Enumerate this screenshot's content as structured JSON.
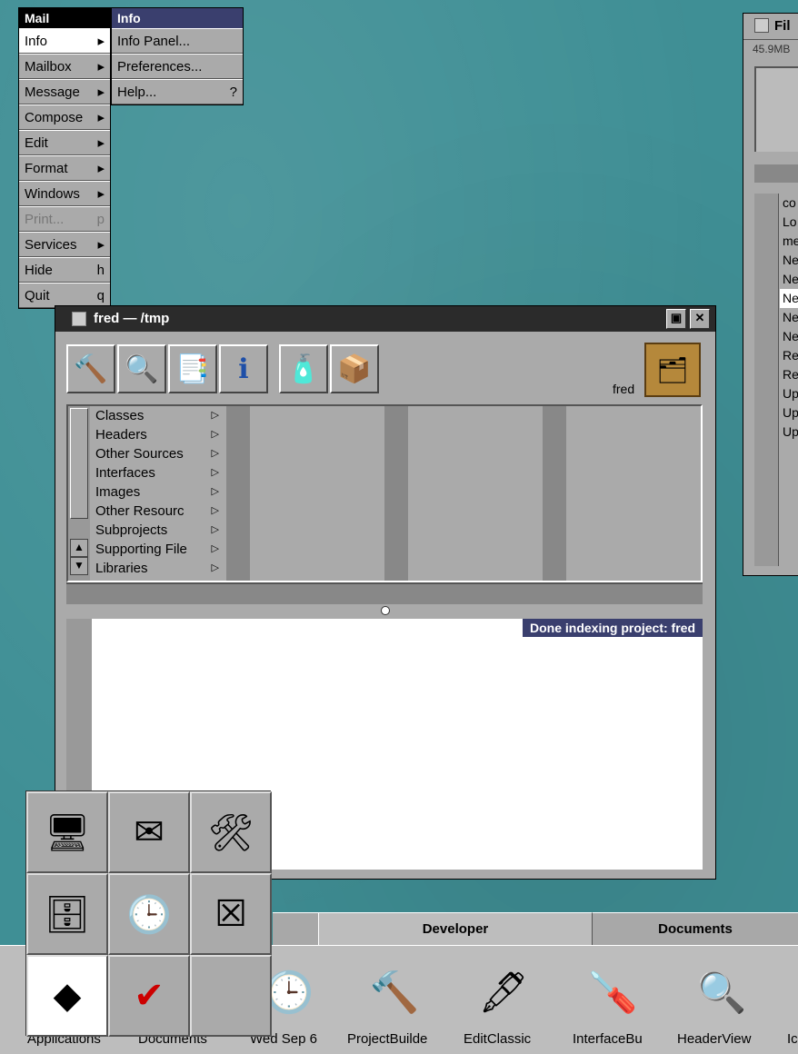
{
  "menu_main": {
    "title": "Mail",
    "items": [
      {
        "label": "Info",
        "key": "▸"
      },
      {
        "label": "Mailbox",
        "key": "▸"
      },
      {
        "label": "Message",
        "key": "▸"
      },
      {
        "label": "Compose",
        "key": "▸"
      },
      {
        "label": "Edit",
        "key": "▸"
      },
      {
        "label": "Format",
        "key": "▸"
      },
      {
        "label": "Windows",
        "key": "▸"
      },
      {
        "label": "Print...",
        "key": "p"
      },
      {
        "label": "Services",
        "key": "▸"
      },
      {
        "label": "Hide",
        "key": "h"
      },
      {
        "label": "Quit",
        "key": "q"
      }
    ]
  },
  "menu_info": {
    "title": "Info",
    "items": [
      {
        "label": "Info Panel...",
        "key": ""
      },
      {
        "label": "Preferences...",
        "key": ""
      },
      {
        "label": "Help...",
        "key": "?"
      }
    ]
  },
  "project_window": {
    "title": "fred — /tmp",
    "project_name": "fred",
    "browser_items": [
      "Classes",
      "Headers",
      "Other Sources",
      "Interfaces",
      "Images",
      "Other Resourc",
      "Subprojects",
      "Supporting File",
      "Libraries"
    ],
    "status": "Done indexing project: fred"
  },
  "file_window": {
    "title": "Fil",
    "size": "45.9MB",
    "rows": [
      "co",
      "Lo",
      "me",
      "Ne",
      "Ne",
      "Ne",
      "Ne",
      "Ne",
      "Re",
      "Re",
      "Up",
      "Up",
      "Up"
    ]
  },
  "shelf": {
    "tabs": [
      "Developer",
      "Documents"
    ],
    "icons": [
      {
        "label": "Applications",
        "icon": "applications-folder-icon"
      },
      {
        "label": "Documents",
        "icon": "documents-folder-icon"
      },
      {
        "label": "Wed Sep 6",
        "icon": "clock-icon"
      },
      {
        "label": "ProjectBuilde",
        "icon": "hammer-icon"
      },
      {
        "label": "EditClassic",
        "icon": "edit-pen-icon"
      },
      {
        "label": "InterfaceBu",
        "icon": "screwdriver-icon"
      },
      {
        "label": "HeaderView",
        "icon": "magnifier-icon"
      },
      {
        "label": "Ic",
        "icon": "app-icon"
      }
    ]
  },
  "dock": {
    "cells": [
      "terminal-icon",
      "mail-icon",
      "project-builder-icon",
      "file-viewer-icon",
      "clock-icon",
      "preferences-icon",
      "next-logo-icon",
      "check-icon",
      "empty"
    ]
  },
  "colors": {
    "desktop": "#3f8f95",
    "menu_bg": "#aaaaaa",
    "title_active": "#2b2b2b",
    "status_bg": "#3a3f6e"
  }
}
